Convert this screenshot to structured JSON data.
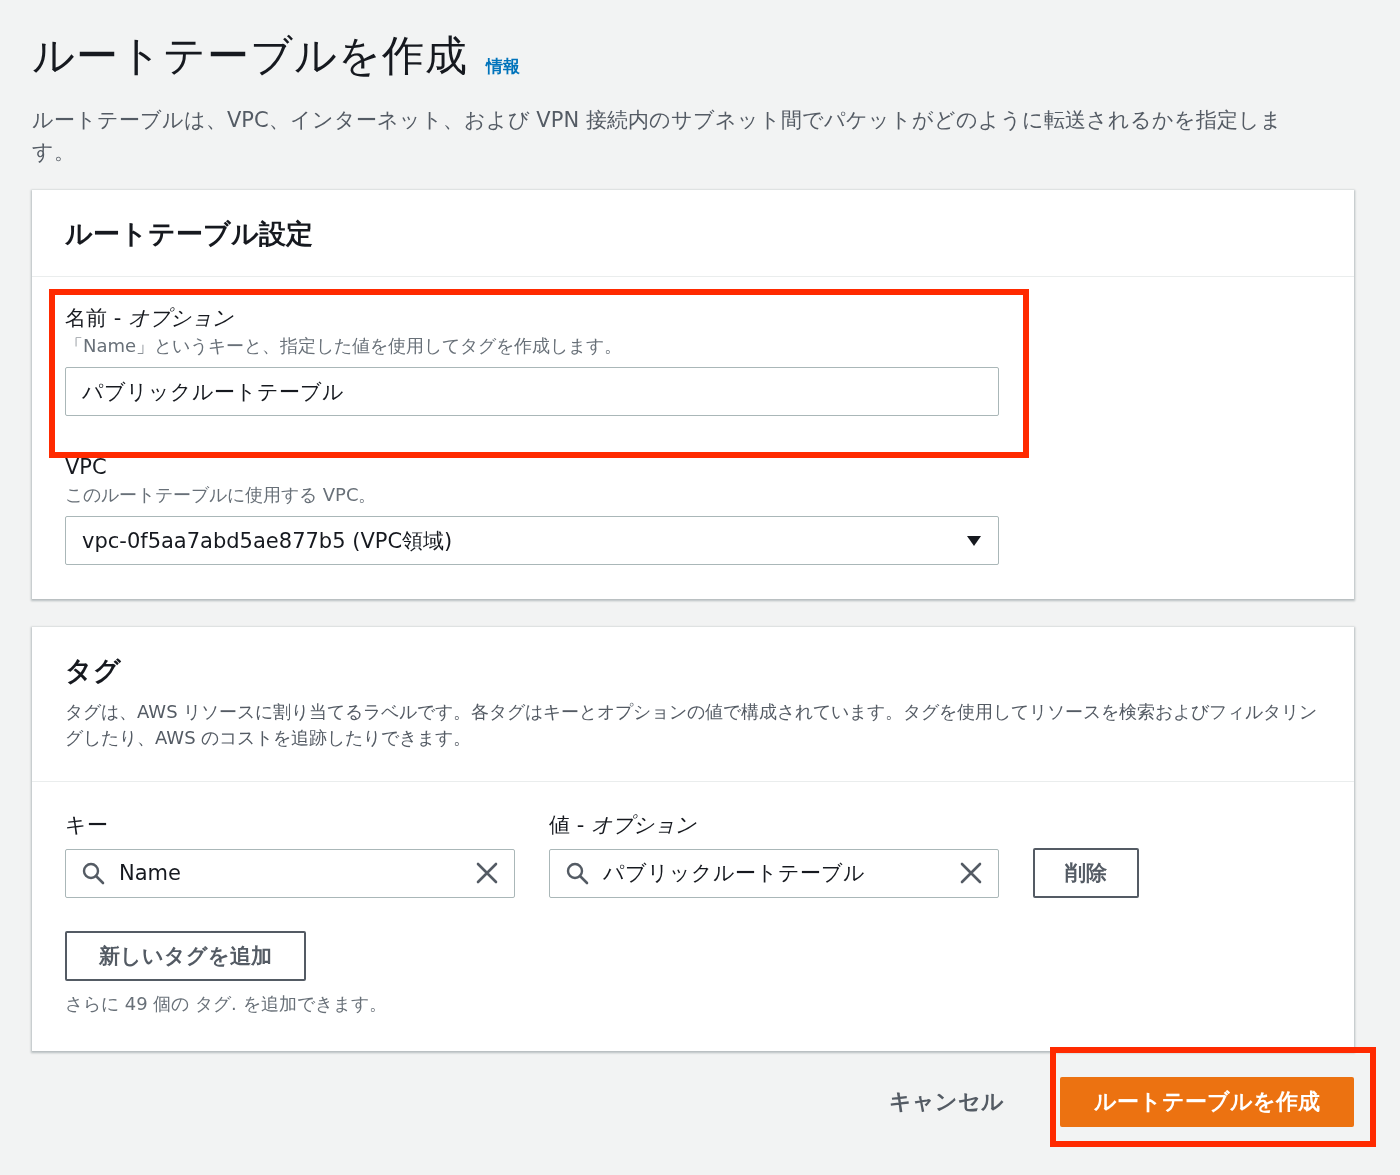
{
  "page": {
    "title": "ルートテーブルを作成",
    "info_link": "情報",
    "description": "ルートテーブルは、VPC、インターネット、および VPN 接続内のサブネット間でパケットがどのように転送されるかを指定します。"
  },
  "settings": {
    "heading": "ルートテーブル設定",
    "fields": [
      {
        "kind": "text",
        "label": "名前 - *オプション*",
        "hint": "「Name」というキーと、指定した値を使用してタグを作成します。",
        "value": "パブリックルートテーブル",
        "highlighted": true
      },
      {
        "kind": "select",
        "label": "VPC",
        "hint": "このルートテーブルに使用する VPC。",
        "value": "vpc-0f5aa7abd5ae877b5 (VPC領域)"
      }
    ]
  },
  "tags": {
    "heading": "タグ",
    "description": "タグは、AWS リソースに割り当てるラベルです。各タグはキーとオプションの値で構成されています。タグを使用してリソースを検索およびフィルタリングしたり、AWS のコストを追跡したりできます。",
    "key_label": "キー",
    "value_label": "値 - *オプション*",
    "rows": [
      {
        "key": "Name",
        "value": "パブリックルートテーブル",
        "remove": "削除"
      }
    ],
    "add_button": "新しいタグを追加",
    "remaining": "さらに 49 個の タグ. を追加できます。"
  },
  "footer": {
    "cancel": "キャンセル",
    "create": "ルートテーブルを作成",
    "create_highlighted": true
  }
}
